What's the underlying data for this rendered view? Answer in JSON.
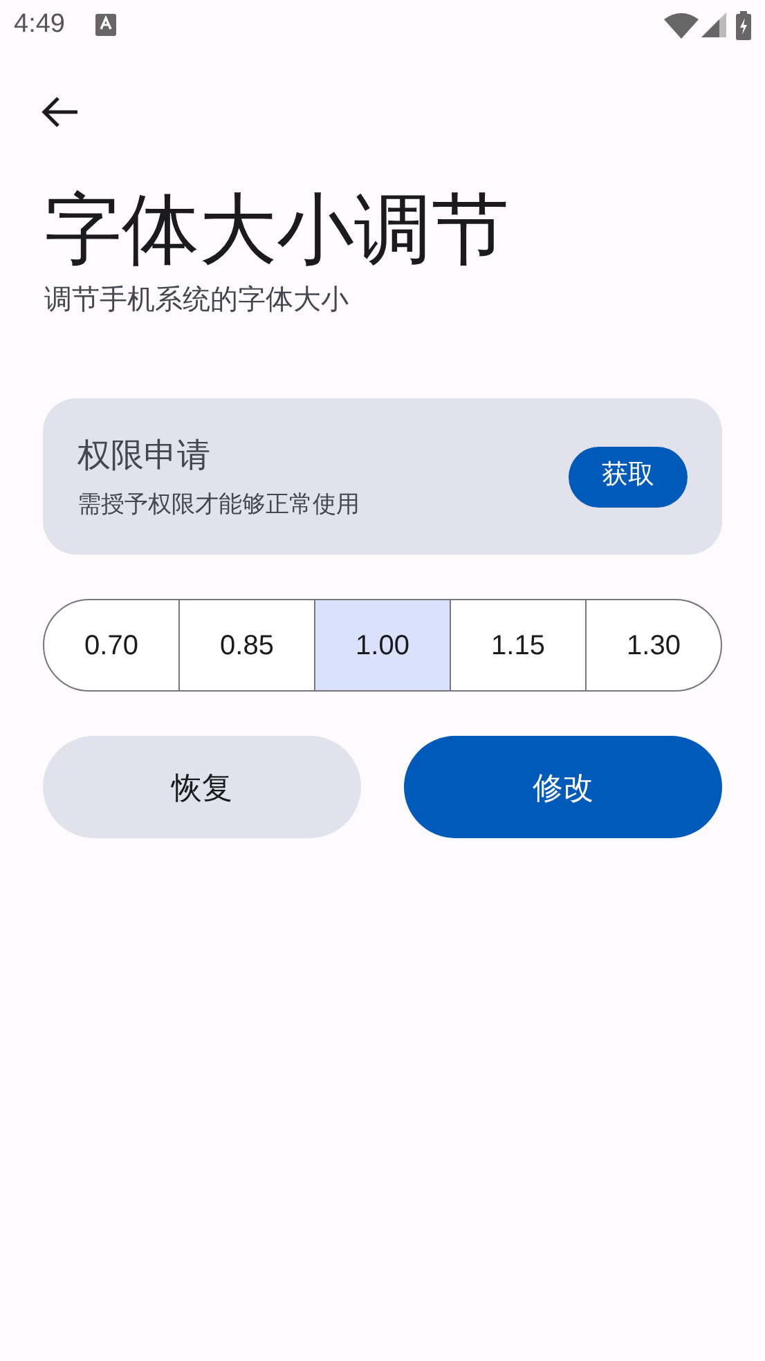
{
  "status_bar": {
    "time": "4:49"
  },
  "title": "字体大小调节",
  "subtitle": "调节手机系统的字体大小",
  "permission_card": {
    "title": "权限申请",
    "description": "需授予权限才能够正常使用",
    "button": "获取"
  },
  "scales": [
    {
      "label": "0.70",
      "selected": false
    },
    {
      "label": "0.85",
      "selected": false
    },
    {
      "label": "1.00",
      "selected": true
    },
    {
      "label": "1.15",
      "selected": false
    },
    {
      "label": "1.30",
      "selected": false
    }
  ],
  "actions": [
    {
      "label": "恢复",
      "kind": "secondary"
    },
    {
      "label": "修改",
      "kind": "primary"
    }
  ]
}
